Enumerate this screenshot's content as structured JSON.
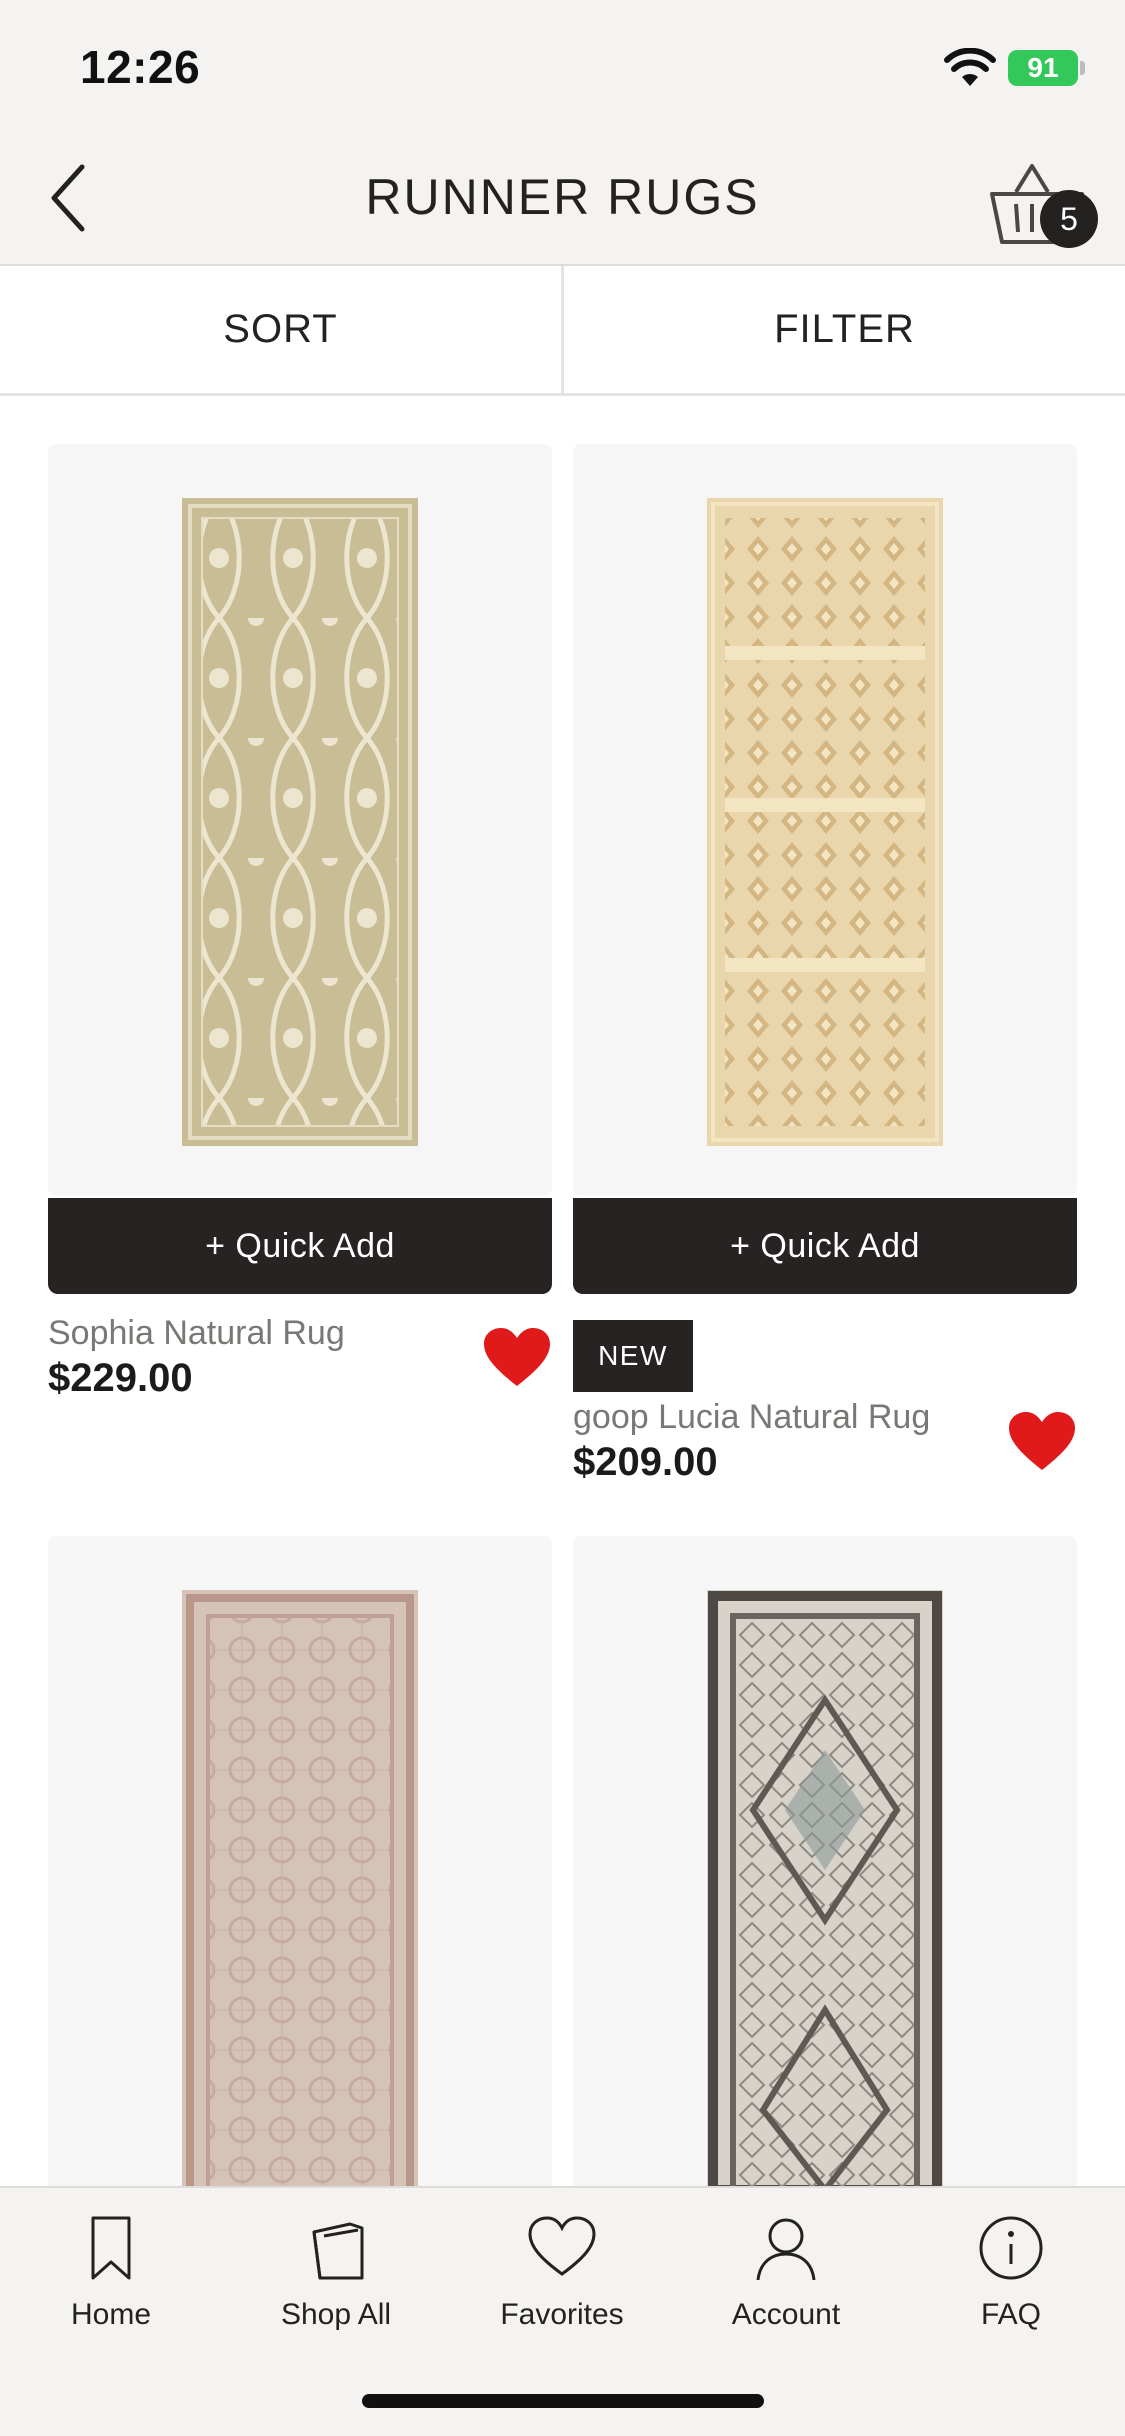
{
  "status_bar": {
    "time": "12:26",
    "battery": "91"
  },
  "header": {
    "title": "RUNNER RUGS",
    "cart_count": "5"
  },
  "toolbar": {
    "sort_label": "SORT",
    "filter_label": "FILTER"
  },
  "quick_add_label": "+ Quick Add",
  "products": [
    {
      "name": "Sophia Natural Rug",
      "price": "$229.00",
      "badge": "",
      "favorited": true
    },
    {
      "name": "goop Lucia Natural Rug",
      "price": "$209.00",
      "badge": "NEW",
      "favorited": true
    },
    {
      "name": "",
      "price": "",
      "badge": "",
      "favorited": false
    },
    {
      "name": "",
      "price": "",
      "badge": "",
      "favorited": false
    }
  ],
  "tabs": [
    {
      "label": "Home",
      "icon": "bookmark-icon"
    },
    {
      "label": "Shop All",
      "icon": "shopping-bag-icon"
    },
    {
      "label": "Favorites",
      "icon": "heart-outline-icon"
    },
    {
      "label": "Account",
      "icon": "user-icon"
    },
    {
      "label": "FAQ",
      "icon": "info-icon"
    }
  ],
  "colors": {
    "accent_dark": "#262322",
    "favorite_red": "#e0191b",
    "header_bg": "#f4f3f1",
    "battery_green": "#34c759"
  }
}
